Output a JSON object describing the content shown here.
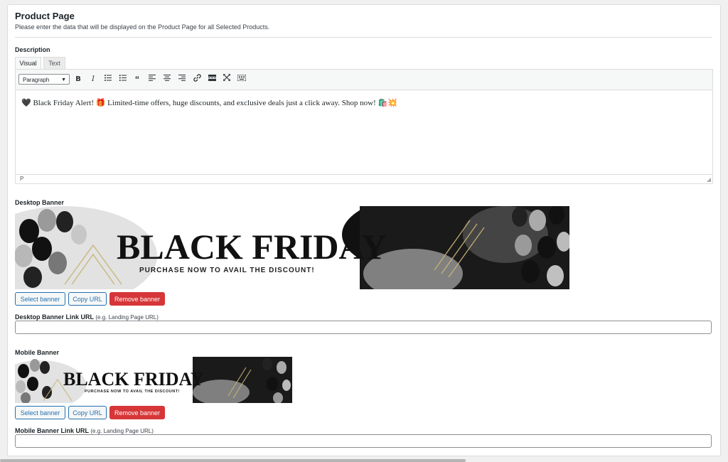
{
  "section": {
    "title": "Product Page",
    "subtitle": "Please enter the data that will be displayed on the Product Page for all Selected Products."
  },
  "description": {
    "label": "Description",
    "tabs": [
      "Visual",
      "Text"
    ],
    "format_select": "Paragraph",
    "toolbar_icons": [
      "bold-icon",
      "italic-icon",
      "bullet-list-icon",
      "numbered-list-icon",
      "blockquote-icon",
      "align-left-icon",
      "align-center-icon",
      "align-right-icon",
      "link-icon",
      "read-more-icon",
      "fullscreen-icon",
      "toolbar-toggle-icon"
    ],
    "content": "🖤 Black Friday Alert! 🎁 Limited-time offers, huge discounts, and exclusive deals just a click away. Shop now! 🛍️💥",
    "status_path": "P"
  },
  "desktop_banner": {
    "label": "Desktop Banner",
    "headline": "BLACK FRIDAY",
    "tagline": "PURCHASE NOW TO AVAIL THE DISCOUNT!",
    "buttons": {
      "select": "Select banner",
      "copy": "Copy URL",
      "remove": "Remove banner"
    },
    "link_label": "Desktop Banner Link URL",
    "link_hint": "(e.g. Landing Page URL)",
    "link_value": ""
  },
  "mobile_banner": {
    "label": "Mobile Banner",
    "headline": "BLACK FRIDAY",
    "tagline": "PURCHASE NOW TO AVAIL THE DISCOUNT!",
    "buttons": {
      "select": "Select banner",
      "copy": "Copy URL",
      "remove": "Remove banner"
    },
    "link_label": "Mobile Banner Link URL",
    "link_hint": "(e.g. Landing Page URL)",
    "link_value": ""
  },
  "colors": {
    "primary": "#2271b1",
    "danger": "#d63638",
    "border": "#dcdcde",
    "background": "#f0f0f1"
  }
}
